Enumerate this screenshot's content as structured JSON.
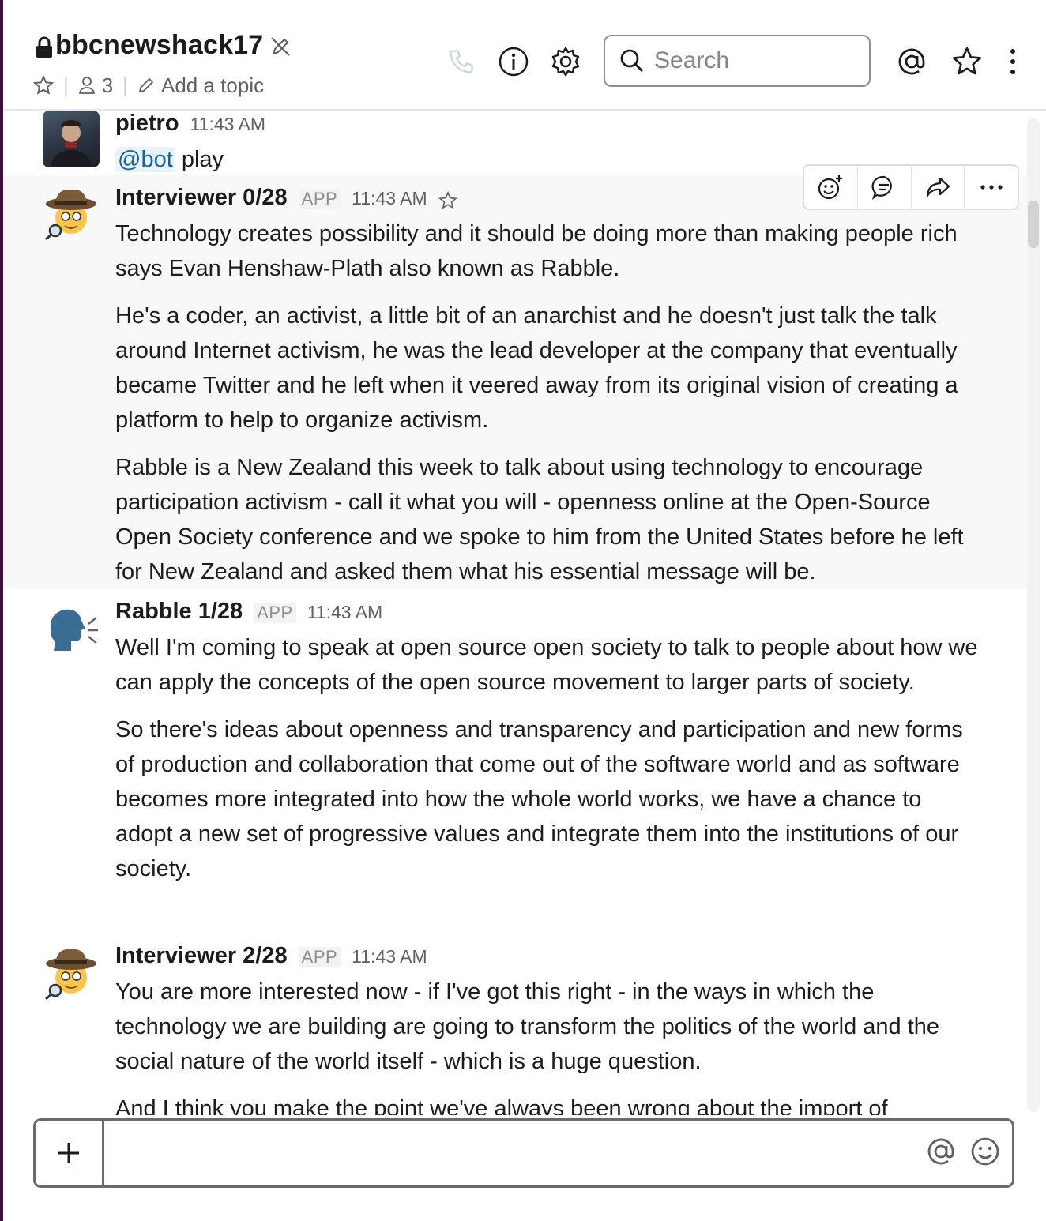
{
  "channel": {
    "name": "bbcnewshack17",
    "members": "3",
    "topic_placeholder": "Add a topic"
  },
  "search": {
    "placeholder": "Search"
  },
  "messages": [
    {
      "author": "pietro",
      "time": "11:43 AM",
      "mention": "@bot",
      "text": "play"
    },
    {
      "author": "Interviewer 0/28",
      "badge": "APP",
      "time": "11:43 AM",
      "paragraphs": [
        "Technology creates possibility and it should be doing more than making people rich says Evan Henshaw-Plath also known as Rabble.",
        "He's a coder, an activist, a little bit of an anarchist and he doesn't just talk the talk around Internet activism, he was the lead developer at the company that eventually became Twitter and he left when it veered away from its original vision of creating a platform to help to organize activism.",
        "Rabble is a New Zealand this week to talk about using technology to encourage participation activism - call it what you will - openness online at the Open-Source Open Society conference and we spoke to him from the United States before he left for New Zealand and asked them what his essential message will be."
      ]
    },
    {
      "author": "Rabble 1/28",
      "badge": "APP",
      "time": "11:43 AM",
      "paragraphs": [
        "Well I'm coming to speak at open source open society to talk to people about how we can apply the concepts of the open source movement to larger parts of society.",
        "So there's ideas about openness and transparency and participation and new forms of production and collaboration that come out of the software world and as software becomes more integrated into how the whole world works, we have a chance to adopt a new set of progressive values and integrate them into the institutions of our society."
      ]
    },
    {
      "author": "Interviewer 2/28",
      "badge": "APP",
      "time": "11:43 AM",
      "paragraphs": [
        "You are more interested now - if I've got this right - in the ways in which the technology we are building are going to transform the politics of the world and the social nature of the world itself - which is a huge question.",
        "And I think you make the point we've always been wrong about the import of technological change and other iterations and stories"
      ]
    }
  ],
  "composer": {
    "value": ""
  },
  "icons": {
    "lock": "lock-icon",
    "mute": "pencil-slash-icon",
    "star": "star-icon",
    "members": "person-icon",
    "pencil": "pencil-icon",
    "call": "phone-icon",
    "info": "info-icon",
    "settings": "gear-icon",
    "search": "search-icon",
    "mentions": "at-icon",
    "more": "kebab-icon",
    "reaction": "add-reaction-icon",
    "thread": "thread-icon",
    "share": "share-icon",
    "attach": "plus-icon",
    "emoji": "emoji-icon"
  },
  "colors": {
    "accent": "#1264a3",
    "sidebar": "#3f0e40",
    "hover_bg": "#f8f8f8"
  }
}
